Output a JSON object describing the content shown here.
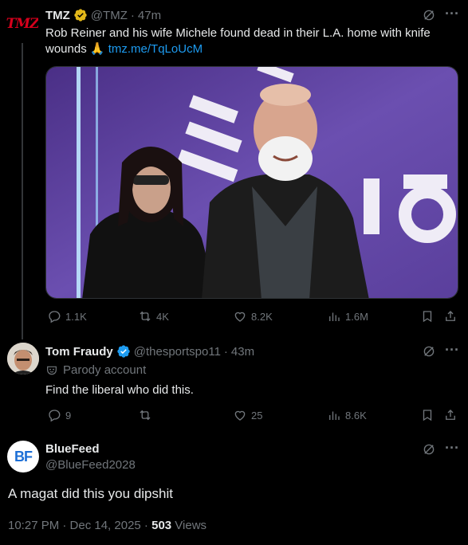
{
  "colors": {
    "accent": "#1d9bf0",
    "verified_gold": "#e2b719",
    "verified_blue": "#1d9bf0",
    "muted": "#71767b",
    "tmz_red": "#d6001c"
  },
  "tweet1": {
    "avatar_text": "TMZ",
    "name": "TMZ",
    "handle": "@TMZ",
    "dot": "·",
    "time": "47m",
    "text": "Rob Reiner and his wife Michele found dead in their L.A. home with knife wounds 🙏",
    "link": "tmz.me/TqLoUcM",
    "image_text": "THE 50",
    "actions": {
      "replies": "1.1K",
      "reposts": "4K",
      "likes": "8.2K",
      "views": "1.6M"
    }
  },
  "tweet2": {
    "name": "Tom Fraudy",
    "handle": "@thesportspo11",
    "dot": "·",
    "time": "43m",
    "label": "Parody account",
    "text": "Find the liberal who did this.",
    "actions": {
      "replies": "9",
      "reposts": "",
      "likes": "25",
      "views": "8.6K"
    }
  },
  "tweet3": {
    "avatar_text": "BF",
    "name": "BlueFeed",
    "handle": "@BlueFeed2028",
    "text": "A magat did this you dipshit",
    "timestamp": "10:27 PM · Dec 14, 2025 · ",
    "views_count": "503",
    "views_label": " Views"
  }
}
